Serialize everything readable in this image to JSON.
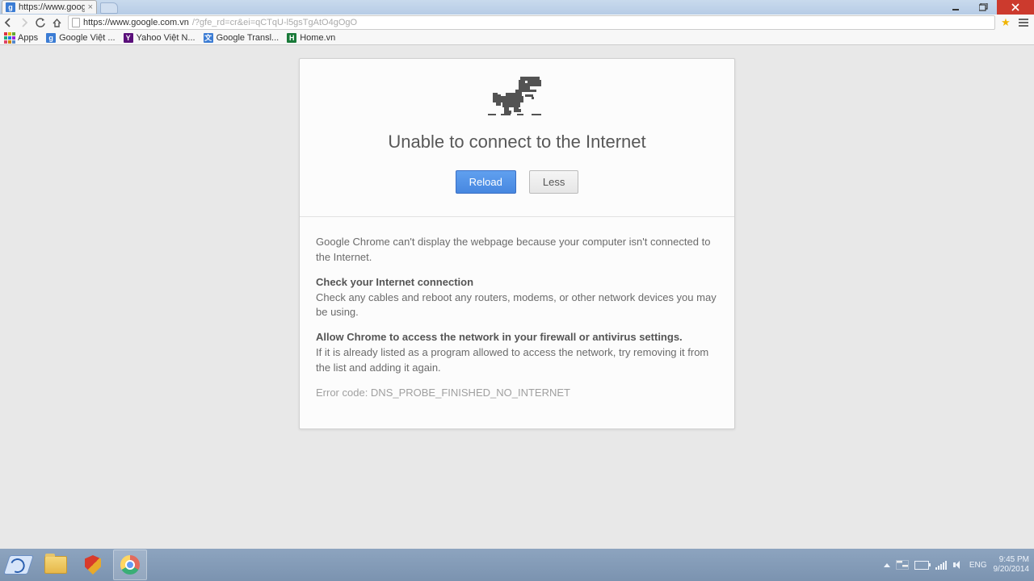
{
  "tab": {
    "title": "https://www.goog"
  },
  "nav": {
    "url_host": "https://www.google.com.vn",
    "url_path": "/?gfe_rd=cr&ei=qCTqU-l5gsTgAtO4gOgO"
  },
  "bookmarks": {
    "apps": "Apps",
    "google": "Google Việt ...",
    "yahoo": "Yahoo Việt N...",
    "gtrans": "Google Transl...",
    "homevn": "Home.vn"
  },
  "error": {
    "headline": "Unable to connect to the Internet",
    "reload": "Reload",
    "less": "Less",
    "msg1": "Google Chrome can't display the webpage because your computer isn't connected to the Internet.",
    "h1": "Check your Internet connection",
    "p1": "Check any cables and reboot any routers, modems, or other network devices you may be using.",
    "h2": "Allow Chrome to access the network in your firewall or antivirus settings.",
    "p2": "If it is already listed as a program allowed to access the network, try removing it from the list and adding it again.",
    "code": "Error code: DNS_PROBE_FINISHED_NO_INTERNET"
  },
  "systray": {
    "lang": "ENG",
    "time": "9:45 PM",
    "date": "9/20/2014"
  }
}
